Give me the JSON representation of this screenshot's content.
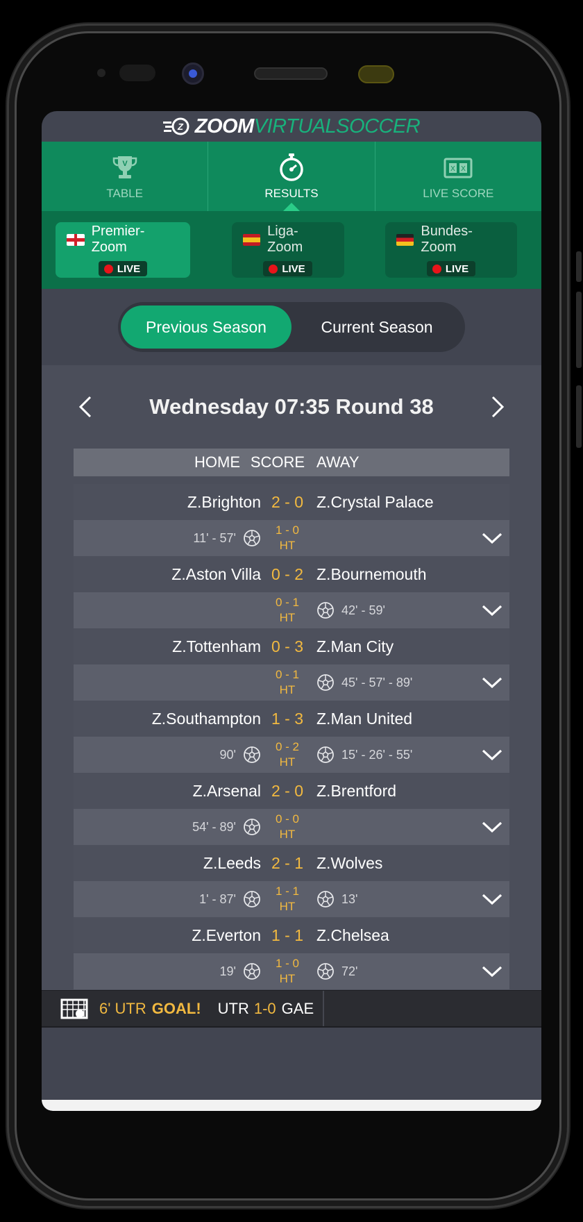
{
  "app": {
    "logo_zoom": "ZOOM",
    "logo_virtualsoccer": "VIRTUALSOCCER"
  },
  "nav": {
    "tabs": [
      {
        "label": "TABLE",
        "icon": "trophy-icon",
        "active": false
      },
      {
        "label": "RESULTS",
        "icon": "stopwatch-icon",
        "active": true
      },
      {
        "label": "LIVE SCORE",
        "icon": "scoreboard-icon",
        "active": false
      }
    ]
  },
  "leagues": [
    {
      "name": "Premier-Zoom",
      "flag": "england-flag-icon",
      "live": "LIVE",
      "active": true
    },
    {
      "name": "Liga-Zoom",
      "flag": "spain-flag-icon",
      "live": "LIVE",
      "active": false
    },
    {
      "name": "Bundes-Zoom",
      "flag": "germany-flag-icon",
      "live": "LIVE",
      "active": false
    }
  ],
  "season": {
    "previous": "Previous Season",
    "current": "Current Season",
    "selected": "previous"
  },
  "round": {
    "title": "Wednesday 07:35 Round 38"
  },
  "table_header": {
    "home": "HOME",
    "score": "SCORE",
    "away": "AWAY"
  },
  "matches": [
    {
      "home": "Z.Brighton",
      "score": "2 - 0",
      "away": "Z.Crystal Palace",
      "home_goals": "11' - 57'",
      "away_goals": "",
      "ht_score": "1 - 0",
      "ht_label": "HT"
    },
    {
      "home": "Z.Aston Villa",
      "score": "0 - 2",
      "away": "Z.Bournemouth",
      "home_goals": "",
      "away_goals": "42' - 59'",
      "ht_score": "0 - 1",
      "ht_label": "HT"
    },
    {
      "home": "Z.Tottenham",
      "score": "0 - 3",
      "away": "Z.Man City",
      "home_goals": "",
      "away_goals": "45' - 57' - 89'",
      "ht_score": "0 - 1",
      "ht_label": "HT"
    },
    {
      "home": "Z.Southampton",
      "score": "1 - 3",
      "away": "Z.Man United",
      "home_goals": "90'",
      "away_goals": "15' - 26' - 55'",
      "ht_score": "0 - 2",
      "ht_label": "HT"
    },
    {
      "home": "Z.Arsenal",
      "score": "2 - 0",
      "away": "Z.Brentford",
      "home_goals": "54' - 89'",
      "away_goals": "",
      "ht_score": "0 - 0",
      "ht_label": "HT"
    },
    {
      "home": "Z.Leeds",
      "score": "2 - 1",
      "away": "Z.Wolves",
      "home_goals": "1' - 87'",
      "away_goals": "13'",
      "ht_score": "1 - 1",
      "ht_label": "HT"
    },
    {
      "home": "Z.Everton",
      "score": "1 - 1",
      "away": "Z.Chelsea",
      "home_goals": "19'",
      "away_goals": "72'",
      "ht_score": "1 - 0",
      "ht_label": "HT"
    }
  ],
  "ticker": {
    "minute": "6' UTR",
    "goal": "GOAL!",
    "home": "UTR",
    "score": "1-0",
    "away": "GAE"
  },
  "colors": {
    "accent_green": "#12a871",
    "score_gold": "#f2b940",
    "live_red": "#e8141a"
  }
}
